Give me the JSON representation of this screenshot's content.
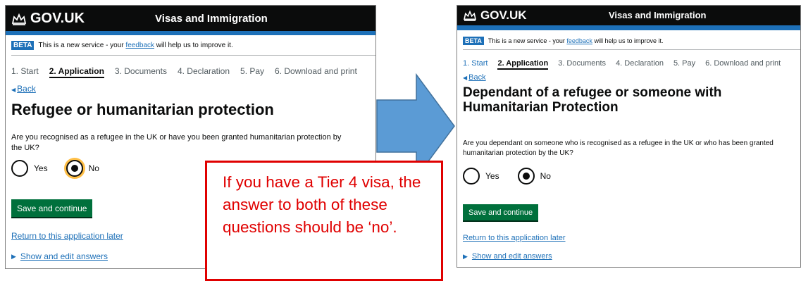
{
  "left": {
    "header": {
      "logo_text": "GOV.UK",
      "service_name": "Visas and Immigration"
    },
    "phase": {
      "tag": "BETA",
      "text_before": "This is a new service - your",
      "link": "feedback",
      "text_after": "will help us to improve it."
    },
    "steps": [
      "1. Start",
      "2. Application",
      "3. Documents",
      "4. Declaration",
      "5. Pay",
      "6. Download and print"
    ],
    "back": "Back",
    "heading": "Refugee or humanitarian protection",
    "question": "Are you recognised as a refugee in the UK or have you been granted humanitarian protection by the UK?",
    "options": {
      "yes": "Yes",
      "no": "No",
      "selected": "No"
    },
    "button": "Save and continue",
    "return_link": "Return to this application later",
    "show_link": "Show and edit answers"
  },
  "right": {
    "header": {
      "logo_text": "GOV.UK",
      "service_name": "Visas and Immigration"
    },
    "phase": {
      "tag": "BETA",
      "text_before": "This is a new service - your",
      "link": "feedback",
      "text_after": "will help us to improve it."
    },
    "steps": [
      "1. Start",
      "2. Application",
      "3. Documents",
      "4. Declaration",
      "5. Pay",
      "6. Download and print"
    ],
    "back": "Back",
    "heading": "Dependant of a refugee or someone with Humanitarian Protection",
    "question": "Are you dependant on someone who is recognised as a refugee in the UK or who has been granted humanitarian protection by the UK?",
    "options": {
      "yes": "Yes",
      "no": "No",
      "selected": "No"
    },
    "button": "Save and continue",
    "return_link": "Return to this application later",
    "show_link": "Show and edit answers"
  },
  "note": {
    "text": "If you have a Tier 4 visa, the answer to both of these questions should be ‘no’."
  },
  "colors": {
    "govuk_black": "#0b0c0c",
    "govuk_blue": "#1d70b8",
    "button_green": "#00703c",
    "arrow_blue": "#5b9bd5",
    "note_red": "#e00000",
    "focus_yellow": "#ffbf47"
  },
  "icons": {
    "crown": "crown-icon",
    "arrow": "right-arrow-icon",
    "back": "back-triangle-icon",
    "disclosure": "play-triangle-icon"
  }
}
